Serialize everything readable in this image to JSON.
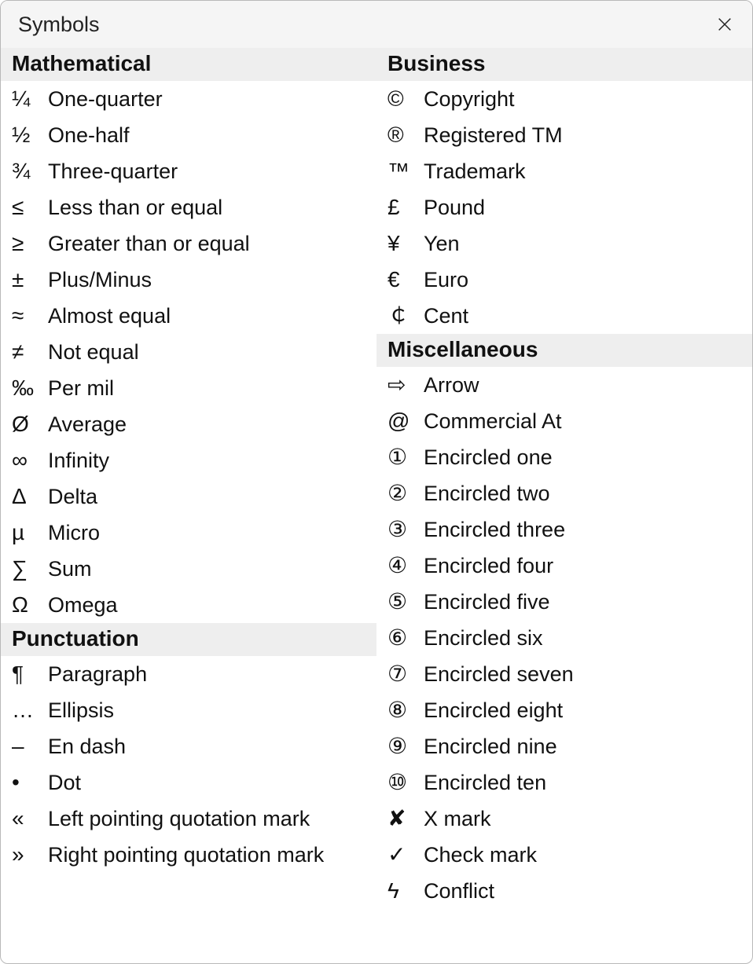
{
  "dialog": {
    "title": "Symbols"
  },
  "categories": {
    "mathematical": {
      "title": "Mathematical",
      "items": [
        {
          "symbol": "¼",
          "label": "One-quarter",
          "name": "one-quarter"
        },
        {
          "symbol": "½",
          "label": "One-half",
          "name": "one-half"
        },
        {
          "symbol": "¾",
          "label": "Three-quarter",
          "name": "three-quarter"
        },
        {
          "symbol": "≤",
          "label": "Less than or equal",
          "name": "less-than-or-equal"
        },
        {
          "symbol": "≥",
          "label": "Greater than or equal",
          "name": "greater-than-or-equal"
        },
        {
          "symbol": "±",
          "label": "Plus/Minus",
          "name": "plus-minus"
        },
        {
          "symbol": "≈",
          "label": "Almost equal",
          "name": "almost-equal"
        },
        {
          "symbol": "≠",
          "label": "Not equal",
          "name": "not-equal"
        },
        {
          "symbol": "‰",
          "label": "Per mil",
          "name": "per-mil"
        },
        {
          "symbol": "Ø",
          "label": "Average",
          "name": "average"
        },
        {
          "symbol": "∞",
          "label": "Infinity",
          "name": "infinity"
        },
        {
          "symbol": "Δ",
          "label": "Delta",
          "name": "delta"
        },
        {
          "symbol": "µ",
          "label": "Micro",
          "name": "micro"
        },
        {
          "symbol": "∑",
          "label": "Sum",
          "name": "sum"
        },
        {
          "symbol": "Ω",
          "label": "Omega",
          "name": "omega"
        }
      ]
    },
    "punctuation": {
      "title": "Punctuation",
      "items": [
        {
          "symbol": "¶",
          "label": "Paragraph",
          "name": "paragraph"
        },
        {
          "symbol": "…",
          "label": "Ellipsis",
          "name": "ellipsis"
        },
        {
          "symbol": "–",
          "label": "En dash",
          "name": "en-dash"
        },
        {
          "symbol": "•",
          "label": "Dot",
          "name": "dot"
        },
        {
          "symbol": "«",
          "label": "Left pointing quotation mark",
          "name": "left-quotation-mark"
        },
        {
          "symbol": "»",
          "label": "Right pointing quotation mark",
          "name": "right-quotation-mark"
        }
      ]
    },
    "business": {
      "title": "Business",
      "items": [
        {
          "symbol": "©",
          "label": "Copyright",
          "name": "copyright"
        },
        {
          "symbol": "®",
          "label": "Registered TM",
          "name": "registered-tm"
        },
        {
          "symbol": "™",
          "label": "Trademark",
          "name": "trademark"
        },
        {
          "symbol": "£",
          "label": "Pound",
          "name": "pound"
        },
        {
          "symbol": "¥",
          "label": "Yen",
          "name": "yen"
        },
        {
          "symbol": "€",
          "label": "Euro",
          "name": "euro"
        },
        {
          "symbol": "￠",
          "label": "Cent",
          "name": "cent"
        }
      ]
    },
    "miscellaneous": {
      "title": "Miscellaneous",
      "items": [
        {
          "symbol": "⇨",
          "label": "Arrow",
          "name": "arrow"
        },
        {
          "symbol": "@",
          "label": "Commercial At",
          "name": "commercial-at"
        },
        {
          "symbol": "①",
          "label": "Encircled one",
          "name": "encircled-one"
        },
        {
          "symbol": "②",
          "label": "Encircled two",
          "name": "encircled-two"
        },
        {
          "symbol": "③",
          "label": "Encircled three",
          "name": "encircled-three"
        },
        {
          "symbol": "④",
          "label": "Encircled four",
          "name": "encircled-four"
        },
        {
          "symbol": "⑤",
          "label": "Encircled five",
          "name": "encircled-five"
        },
        {
          "symbol": "⑥",
          "label": "Encircled six",
          "name": "encircled-six"
        },
        {
          "symbol": "⑦",
          "label": "Encircled seven",
          "name": "encircled-seven"
        },
        {
          "symbol": "⑧",
          "label": "Encircled eight",
          "name": "encircled-eight"
        },
        {
          "symbol": "⑨",
          "label": "Encircled nine",
          "name": "encircled-nine"
        },
        {
          "symbol": "⑩",
          "label": "Encircled ten",
          "name": "encircled-ten"
        },
        {
          "symbol": "✘",
          "label": "X mark",
          "name": "x-mark"
        },
        {
          "symbol": "✓",
          "label": "Check mark",
          "name": "check-mark"
        },
        {
          "symbol": "ϟ",
          "label": "Conflict",
          "name": "conflict"
        }
      ]
    }
  },
  "layout": {
    "left": [
      "mathematical",
      "punctuation"
    ],
    "right": [
      "business",
      "miscellaneous"
    ]
  }
}
